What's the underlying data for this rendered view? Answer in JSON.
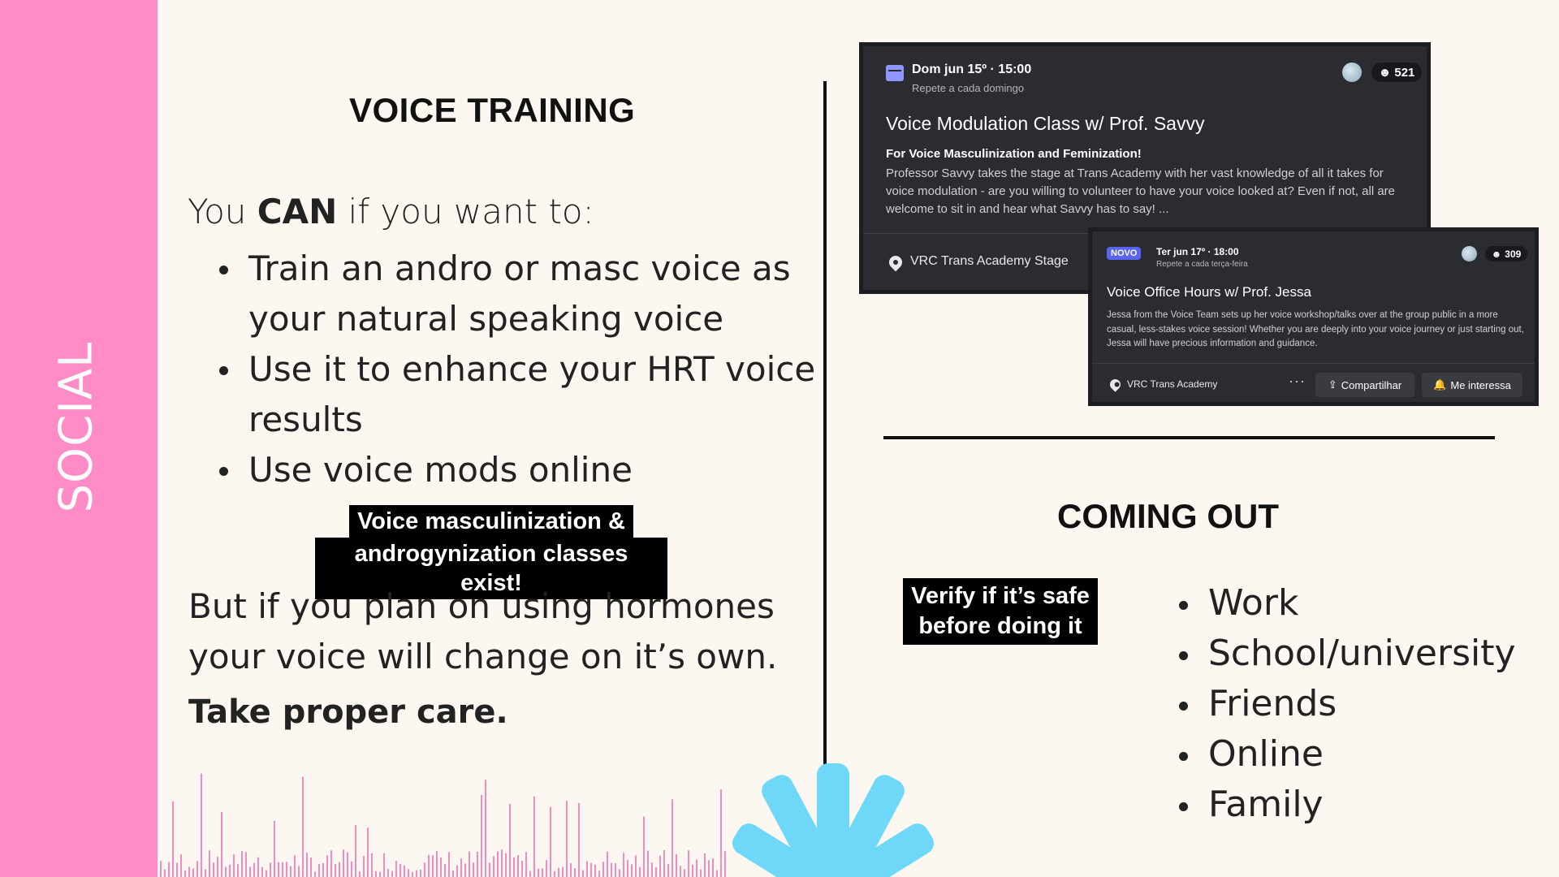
{
  "sidebar": {
    "title": "SOCIAL",
    "color": "#ff8cc6"
  },
  "voice_training": {
    "heading": "VOICE TRAINING",
    "intro_prefix": "You ",
    "intro_bold": "CAN",
    "intro_suffix": " if you want to:",
    "bullets": [
      "Train an andro or masc voice as your natural speaking voice",
      "Use it to enhance your HRT voice results",
      "Use voice mods online"
    ],
    "badge_line1": "Voice masculinization &",
    "badge_line2": "androgynization classes exist!",
    "outro": "But if you plan on using hormones your voice will change on it’s own.",
    "care": "Take proper care."
  },
  "event1": {
    "date": "Dom jun 15º · 15:00",
    "repeat": "Repete a cada domingo",
    "count": "521",
    "title": "Voice Modulation Class w/ Prof. Savvy",
    "subtitle": "For Voice Masculinization and Feminization!",
    "description": "Professor Savvy takes the stage at Trans Academy with her vast knowledge of all it takes for voice modulation - are you willing to volunteer to have your voice looked at? Even if not, all are welcome to sit in and hear what Savvy has to say! ...",
    "location": "VRC Trans Academy Stage"
  },
  "event2": {
    "badge": "NOVO",
    "date": "Ter jun 17º · 18:00",
    "repeat": "Repete a cada terça-feira",
    "count": "309",
    "title": "Voice Office Hours w/ Prof. Jessa",
    "description": "Jessa from the Voice Team sets up her voice workshop/talks over at the group public in a more casual, less-stakes voice session! Whether you are deeply into your voice journey or just starting out, Jessa will have precious information and guidance.",
    "location": "VRC Trans Academy",
    "more": "···",
    "share_label": "Compartilhar",
    "interest_label": "Me interessa"
  },
  "coming_out": {
    "heading": "COMING OUT",
    "badge_line1": "Verify if it’s safe",
    "badge_line2": "before doing it",
    "items": [
      "Work",
      "School/university",
      "Friends",
      "Online",
      "Family"
    ]
  },
  "colors": {
    "accent_pink": "#ff8cc6",
    "accent_blue": "#6fd8f8",
    "card_bg": "#2b2c31"
  }
}
